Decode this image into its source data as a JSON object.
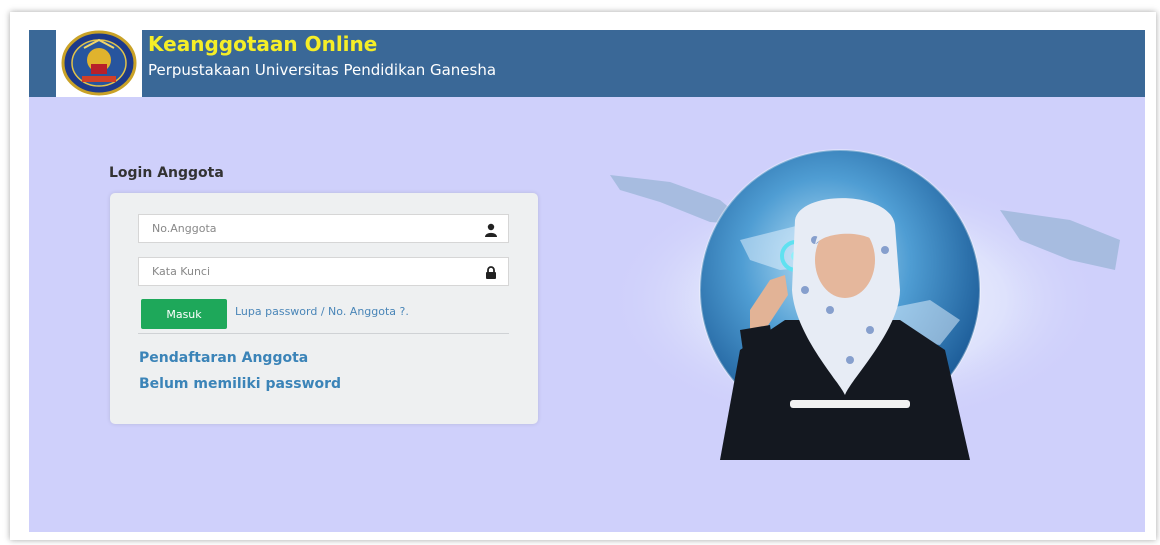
{
  "header": {
    "title": "Keanggotaan Online",
    "subtitle": "Perpustakaan Universitas Pendidikan Ganesha",
    "background": "#3a6897",
    "title_color": "#f5ee27"
  },
  "logo": {
    "icon": "university-seal-logo"
  },
  "login": {
    "heading": "Login Anggota",
    "member_no": {
      "placeholder": "No.Anggota",
      "value": "",
      "icon": "user-icon"
    },
    "password": {
      "placeholder": "Kata Kunci",
      "value": "",
      "icon": "lock-icon"
    },
    "submit_label": "Masuk",
    "forgot_label": "Lupa password / No. Anggota ?.",
    "register_label": "Pendaftaran Anggota",
    "no_password_label": "Belum memiliki password"
  },
  "colors": {
    "content_background": "#cfd0fb",
    "button": "#1ea85a",
    "link": "#3b84b8"
  }
}
